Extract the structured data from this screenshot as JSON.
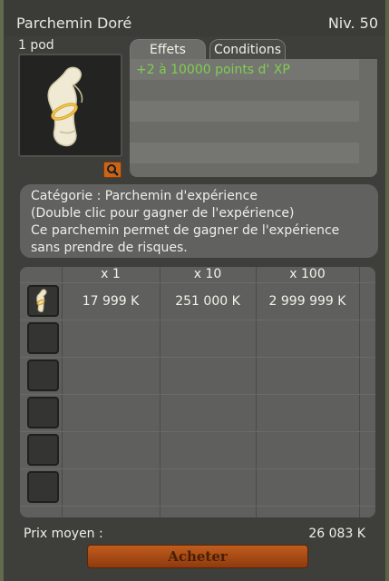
{
  "window": {
    "title": "Parchemin Doré",
    "level": "Niv. 50",
    "weight": "1 pod"
  },
  "item_icon": "rolled-parchment-icon",
  "tabs": [
    {
      "label": "Effets",
      "active": true
    },
    {
      "label": "Conditions",
      "active": false
    }
  ],
  "effects": [
    "+2 à 10000 points d' XP"
  ],
  "description": [
    "Catégorie : Parchemin d'expérience",
    "(Double clic pour gagner de l'expérience)",
    "Ce parchemin permet de gagner de l'expérience",
    "sans prendre de risques."
  ],
  "price_table": {
    "headers": [
      "x 1",
      "x 10",
      "x 100"
    ],
    "rows": [
      {
        "icon": "rolled-parchment-icon",
        "prices": [
          "17 999 K",
          "251 000 K",
          "2 999 999 K"
        ]
      }
    ],
    "empty_slots": 5
  },
  "average_price": {
    "label": "Prix moyen :",
    "value": "26 083 K"
  },
  "buy_button": "Acheter",
  "colors": {
    "effect_text": "#7fcf4e",
    "buy_button": "#b1531a",
    "magnify_button": "#c9651b"
  }
}
